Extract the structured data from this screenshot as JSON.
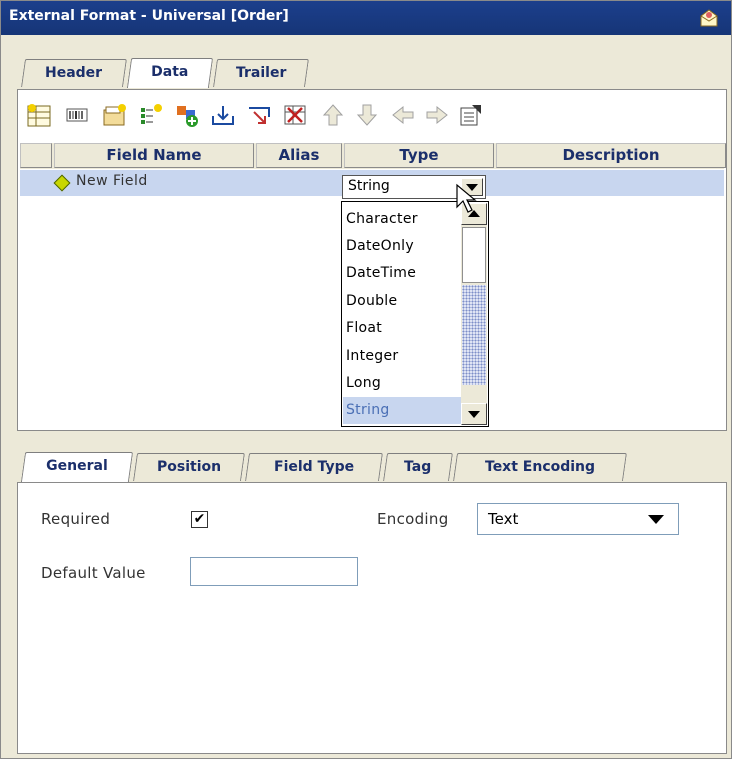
{
  "window": {
    "title": "External Format - Universal [Order]"
  },
  "top_tabs": [
    {
      "label": "Header"
    },
    {
      "label": "Data"
    },
    {
      "label": "Trailer"
    }
  ],
  "toolbar_icons": [
    "new-record-icon",
    "barcode-icon",
    "folder-add-icon",
    "add-field-icon",
    "add-group-icon",
    "import-icon",
    "export-icon",
    "delete-icon",
    "move-up-icon",
    "move-down-icon",
    "move-left-icon",
    "move-right-icon",
    "properties-icon"
  ],
  "grid": {
    "columns": [
      "Field Name",
      "Alias",
      "Type",
      "Description"
    ],
    "rows": [
      {
        "field_name": "New Field",
        "alias": "",
        "type": "String",
        "description": ""
      }
    ]
  },
  "type_dropdown": {
    "selected": "String",
    "options": [
      "Character",
      "DateOnly",
      "DateTime",
      "Double",
      "Float",
      "Integer",
      "Long",
      "String"
    ]
  },
  "bottom_tabs": [
    {
      "label": "General"
    },
    {
      "label": "Position"
    },
    {
      "label": "Field Type"
    },
    {
      "label": "Tag"
    },
    {
      "label": "Text Encoding"
    }
  ],
  "general": {
    "required_label": "Required",
    "required_mark": "✔",
    "encoding_label": "Encoding",
    "encoding_value": "Text",
    "default_value_label": "Default Value",
    "default_value": ""
  },
  "colors": {
    "title_bar": "#1c3f8c",
    "selection": "#c8d6ef",
    "tab_text": "#1b2f6b"
  }
}
